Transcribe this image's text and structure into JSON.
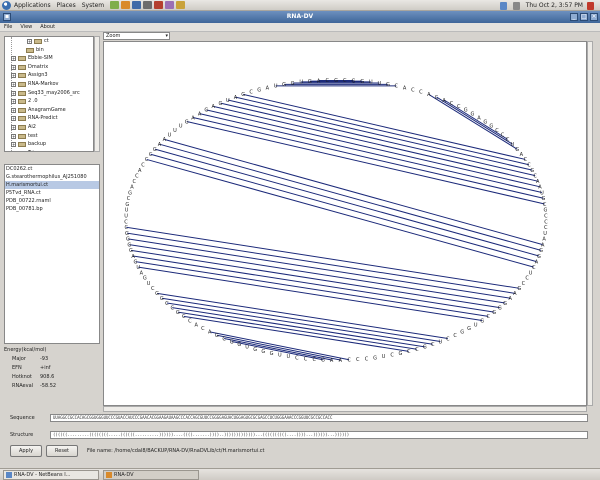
{
  "panel": {
    "menus": [
      "Applications",
      "Places",
      "System"
    ],
    "clock": "Thu Oct  2,  3:57 PM"
  },
  "window": {
    "title": "RNA-DV"
  },
  "menubar": {
    "items": [
      "File",
      "View",
      "About"
    ]
  },
  "tree": {
    "items": [
      {
        "label": "ct",
        "depth": 3,
        "expander": "+"
      },
      {
        "label": "bin",
        "depth": 2,
        "expander": ""
      },
      {
        "label": "Ebbie-SIM",
        "depth": 1,
        "expander": "+"
      },
      {
        "label": "Dmatrix",
        "depth": 1,
        "expander": "+"
      },
      {
        "label": "Assign3",
        "depth": 1,
        "expander": "+"
      },
      {
        "label": "RNA-Markov",
        "depth": 1,
        "expander": "+"
      },
      {
        "label": "Seq33_may2006_src",
        "depth": 1,
        "expander": "+"
      },
      {
        "label": "2 .0",
        "depth": 1,
        "expander": "+"
      },
      {
        "label": "AnagramGame",
        "depth": 1,
        "expander": "+"
      },
      {
        "label": "RNA-Predict",
        "depth": 1,
        "expander": "+"
      },
      {
        "label": "Ai2",
        "depth": 1,
        "expander": "+"
      },
      {
        "label": "test",
        "depth": 1,
        "expander": "+"
      },
      {
        "label": "backup",
        "depth": 1,
        "expander": "+"
      },
      {
        "label": "Tricam...",
        "depth": 1,
        "expander": "+"
      }
    ]
  },
  "files": {
    "items": [
      "DC0262.ct",
      "G.stearothermophilus_AJ251080",
      "H.marismortui.ct",
      "P5Tvd_RNA.ct",
      "PDB_00722.rnaml",
      "PDB_00781.bp"
    ],
    "selected": 2
  },
  "energy": {
    "header": "Energy(kcal/mol)",
    "rows": [
      {
        "key": "Major",
        "value": "-93"
      },
      {
        "key": "EFN",
        "value": "+inf"
      },
      {
        "key": "Hotknot",
        "value": "908.6"
      },
      {
        "key": "RNAeval",
        "value": "-58.52"
      }
    ]
  },
  "zoom": {
    "label": "Zoom"
  },
  "sequence": {
    "label": "Sequence",
    "value": "UUAGGCCGCCACAGCGGUGGGUUCCCGUACCAUCCCGAACACGGAAGAUAAGCCCACCAGCGUUCCGGGGAGUACUGGAGUGCGCGAGCCUCUGGGAAACCCGGUUCGCCGCCACC"
  },
  "structure": {
    "label": "Structure",
    "value": "((((((.........((((((((.....((((((..........))))))....((((.......))))..)))))))))))))...((((((((((....))))...))))))...))))))"
  },
  "buttons": {
    "apply": "Apply",
    "reset": "Reset"
  },
  "filename": {
    "text": "File name: /home/cdal8/BACKUP/RNA-DV/RnaDVLib/ct/H.marismortui.ct"
  },
  "taskbar": {
    "tasks": [
      "RNA-DV - NetBeans I...",
      "RNA-DV"
    ]
  },
  "colors": {
    "arc": "#1c2a7a",
    "selection": "#b8c9e4",
    "titlebar": "#4d74a8"
  },
  "arc_diagram": {
    "sequence": "GCAGUGGUAGCGAUGAGAAGUUUAAGCCCACCAGCGUUCCGGGGAGUAGUCGGCCGCCACAGCGGUGGGUUCCCGAACCCGUCGCCGCUCCGGUGCGGGAAGCCUCAGGAAUCCCGCGUAACGCCAGUCCCGGAGGCCACACCACGUUGGC",
    "pairs": [
      [
        3,
        150
      ],
      [
        4,
        149
      ],
      [
        5,
        148
      ],
      [
        6,
        147
      ],
      [
        7,
        146
      ],
      [
        8,
        145
      ],
      [
        12,
        125
      ],
      [
        13,
        124
      ],
      [
        14,
        123
      ],
      [
        15,
        122
      ],
      [
        16,
        121
      ],
      [
        17,
        120
      ],
      [
        18,
        119
      ],
      [
        19,
        118
      ],
      [
        20,
        117
      ],
      [
        24,
        110
      ],
      [
        25,
        109
      ],
      [
        26,
        108
      ],
      [
        27,
        107
      ],
      [
        28,
        106
      ],
      [
        40,
        102
      ],
      [
        41,
        101
      ],
      [
        42,
        100
      ],
      [
        43,
        99
      ],
      [
        44,
        98
      ],
      [
        45,
        97
      ],
      [
        46,
        96
      ],
      [
        47,
        95
      ],
      [
        52,
        90
      ],
      [
        53,
        89
      ],
      [
        54,
        88
      ],
      [
        55,
        87
      ],
      [
        56,
        86
      ],
      [
        57,
        85
      ],
      [
        61,
        78
      ],
      [
        62,
        77
      ],
      [
        63,
        76
      ],
      [
        64,
        75
      ],
      [
        127,
        141
      ],
      [
        128,
        140
      ],
      [
        129,
        139
      ]
    ]
  }
}
